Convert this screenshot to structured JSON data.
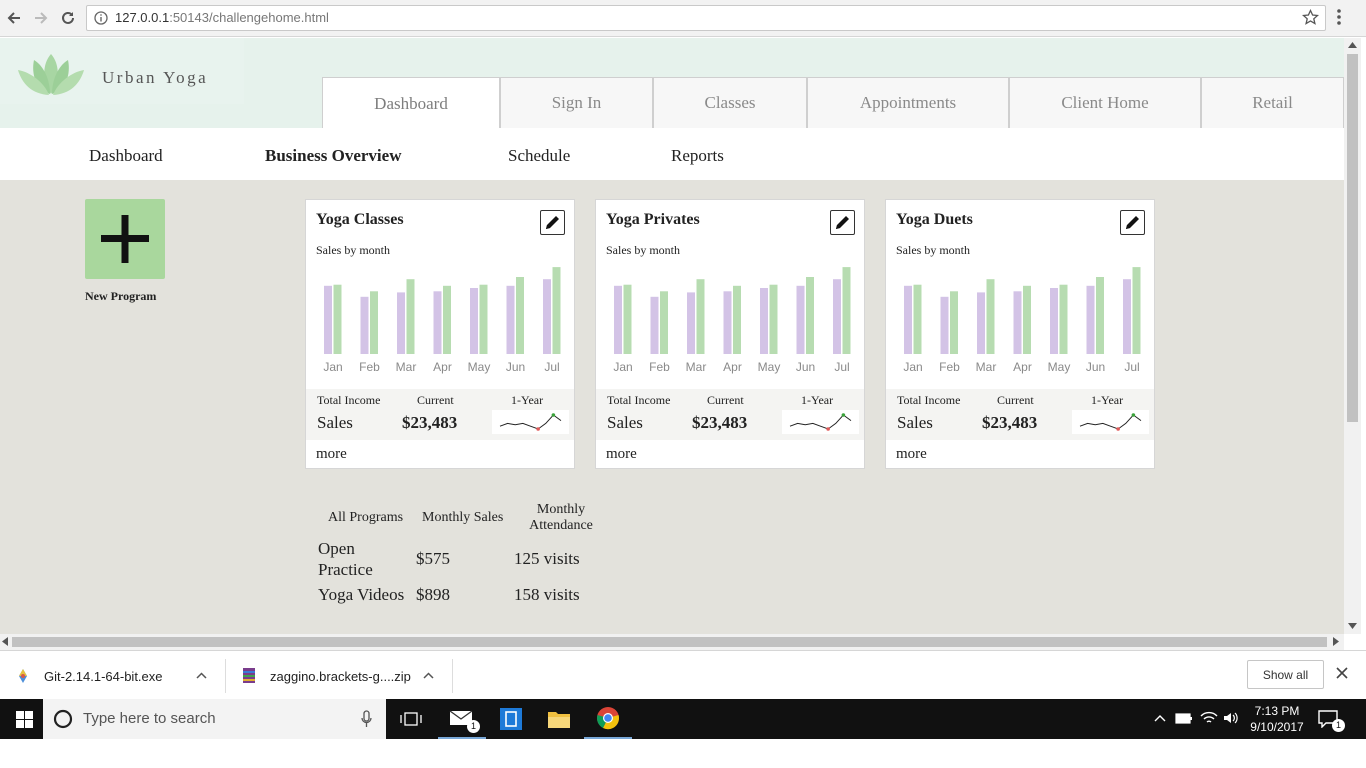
{
  "browser": {
    "url_host": "127.0.0.1",
    "url_rest": ":50143/challengehome.html"
  },
  "brand": {
    "name": "Urban Yoga"
  },
  "main_tabs": [
    {
      "label": "Dashboard",
      "active": true
    },
    {
      "label": "Sign In"
    },
    {
      "label": "Classes"
    },
    {
      "label": "Appointments"
    },
    {
      "label": "Client Home"
    },
    {
      "label": "Retail"
    }
  ],
  "subnav": [
    {
      "label": "Dashboard"
    },
    {
      "label": "Business Overview",
      "active": true
    },
    {
      "label": "Schedule"
    },
    {
      "label": "Reports"
    }
  ],
  "new_program": {
    "label": "New Program"
  },
  "cards": [
    {
      "title": "Yoga Classes",
      "subtitle": "Sales by month",
      "stat_headers": [
        "Total Income",
        "Current",
        "1-Year"
      ],
      "sales_label": "Sales",
      "current_value": "$23,483",
      "more_label": "more"
    },
    {
      "title": "Yoga Privates",
      "subtitle": "Sales by month",
      "stat_headers": [
        "Total Income",
        "Current",
        "1-Year"
      ],
      "sales_label": "Sales",
      "current_value": "$23,483",
      "more_label": "more"
    },
    {
      "title": "Yoga Duets",
      "subtitle": "Sales by month",
      "stat_headers": [
        "Total Income",
        "Current",
        "1-Year"
      ],
      "sales_label": "Sales",
      "current_value": "$23,483",
      "more_label": "more"
    }
  ],
  "chart_data": {
    "type": "bar",
    "categories": [
      "Jan",
      "Feb",
      "Mar",
      "Apr",
      "May",
      "Jun",
      "Jul"
    ],
    "series": [
      {
        "color": "#d3c3e6",
        "values": [
          62,
          52,
          56,
          57,
          60,
          62,
          68
        ]
      },
      {
        "color": "#b7dcb1",
        "values": [
          63,
          57,
          68,
          62,
          63,
          70,
          79
        ]
      }
    ],
    "ylim": [
      0,
      80
    ],
    "grid": false,
    "legend": "none"
  },
  "sparkline": {
    "values": [
      4,
      5,
      4.5,
      5,
      4,
      3,
      5,
      8,
      6
    ],
    "colors": {
      "line": "#222222",
      "low_marker": "#e05a5a",
      "high_marker": "#3aa23a"
    }
  },
  "programs_table": {
    "headers": [
      "All Programs",
      "Monthly Sales",
      "Monthly\nAttendance"
    ],
    "rows": [
      {
        "name_line1": "Open",
        "name_line2": "Practice",
        "sales": "$575",
        "attendance": "125 visits"
      },
      {
        "name_line1": "Yoga Videos",
        "name_line2": "",
        "sales": "$898",
        "attendance": "158 visits"
      }
    ]
  },
  "downloads": {
    "items": [
      {
        "name": "Git-2.14.1-64-bit.exe"
      },
      {
        "name": "zaggino.brackets-g....zip"
      }
    ],
    "show_all_label": "Show all"
  },
  "taskbar": {
    "search_placeholder": "Type here to search",
    "mail_badge": "1",
    "notification_badge": "1",
    "time": "7:13 PM",
    "date": "9/10/2017"
  },
  "colors": {
    "accent_green": "#a9d79d",
    "page_bg": "#e3e2dc",
    "header_bg": "#e6f2ec"
  }
}
